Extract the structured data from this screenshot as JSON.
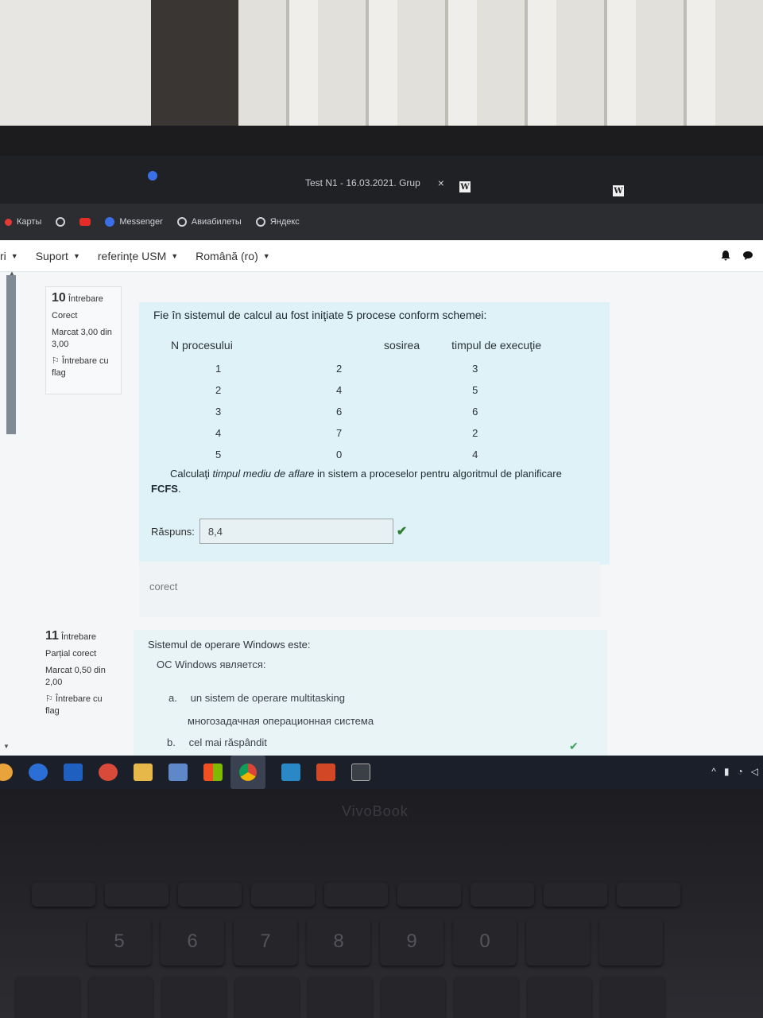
{
  "browser": {
    "active_tab_title": "Test N1 - 16.03.2021. Grup",
    "tab_close": "×",
    "wiki_tab_letter": "W"
  },
  "bookmarks": [
    {
      "label": "Карты",
      "icon": "maps-icon"
    },
    {
      "label": "",
      "icon": "globe-icon"
    },
    {
      "label": "",
      "icon": "youtube-icon"
    },
    {
      "label": "Messenger",
      "icon": "messenger-icon"
    },
    {
      "label": "Авиабилеты",
      "icon": "globe-icon"
    },
    {
      "label": "Яндекс",
      "icon": "globe-icon"
    }
  ],
  "site_nav": {
    "items": [
      "ri",
      "Suport",
      "referințe USM",
      "Română (ro)"
    ],
    "caret": "▼"
  },
  "question10": {
    "number": "10",
    "word": "Întrebare",
    "state": "Corect",
    "grade": "Marcat 3,00 din 3,00",
    "flag": "Întrebare cu flag",
    "intro": "Fie în sistemul de calcul au fost iniţiate  5 procese conform schemei:",
    "table": {
      "headers": [
        "N procesului",
        "sosirea",
        "timpul de execuţie"
      ],
      "rows": [
        [
          "1",
          "2",
          "3"
        ],
        [
          "2",
          "4",
          "5"
        ],
        [
          "3",
          "6",
          "6"
        ],
        [
          "4",
          "7",
          "2"
        ],
        [
          "5",
          "0",
          "4"
        ]
      ]
    },
    "task_prefix": "Calculaţi ",
    "task_italic": "timpul mediu de aflare",
    "task_suffix": " in sistem a proceselor pentru algoritmul de planificare",
    "task_bold": "FCFS",
    "task_end": ".",
    "answer_label": "Răspuns:",
    "answer_value": "8,4",
    "feedback": "corect"
  },
  "question11": {
    "number": "11",
    "word": "Întrebare",
    "state": "Parțial corect",
    "grade": "Marcat 0,50 din 2,00",
    "flag": "Întrebare cu flag",
    "title": "Sistemul de operare Windows este:",
    "subtitle": "ОС Windows является:",
    "options": [
      {
        "letter": "a.",
        "text": "un sistem de operare multitasking",
        "translation": "многозадачная операционная система"
      },
      {
        "letter": "b.",
        "text": "cel mai răspândit",
        "translation": ""
      }
    ]
  },
  "device": {
    "brand": "VivoBook"
  },
  "keyboard": {
    "number_keys": [
      "5",
      "6",
      "7",
      "8",
      "9",
      "0"
    ]
  },
  "colors": {
    "question_bg": "#def2f8",
    "correct_check": "#2e7d32",
    "taskbar_bg": "#1b1f2a"
  }
}
